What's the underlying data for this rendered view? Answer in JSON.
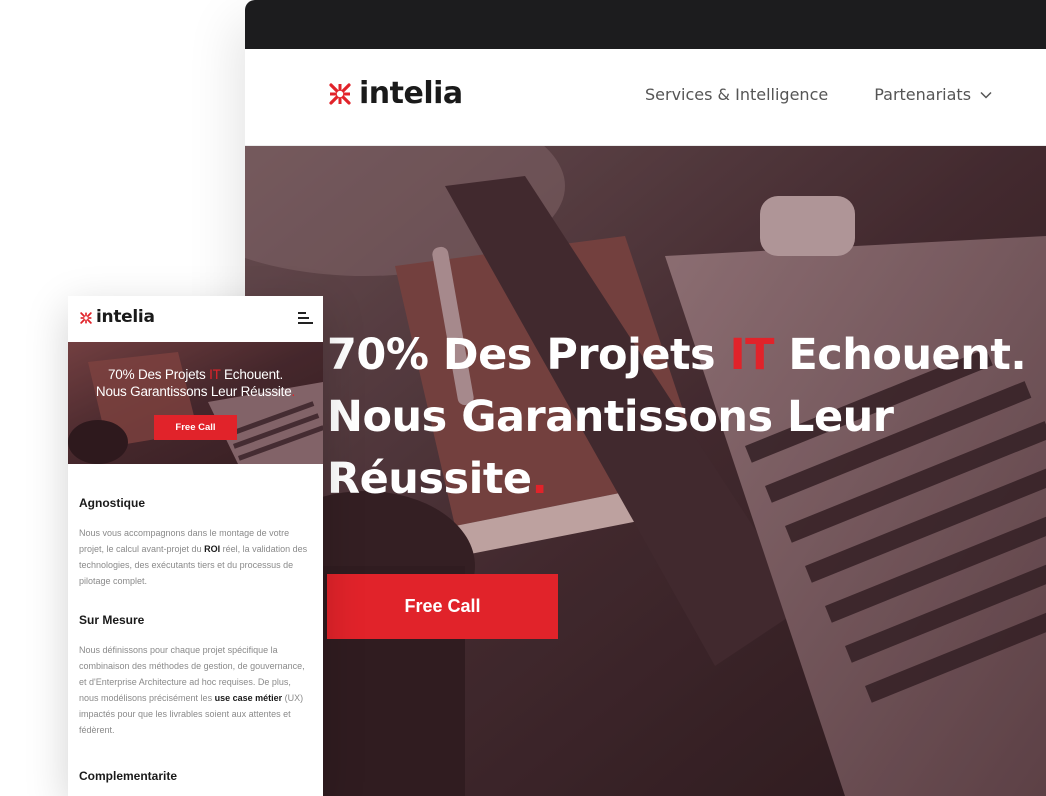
{
  "brand": {
    "name": "intelia",
    "accent": "#e1232a",
    "dark": "#1c1c1e"
  },
  "desktop": {
    "nav": {
      "items": [
        {
          "label": "Services & Intelligence"
        },
        {
          "label": "Partenariats",
          "icon": "chevron-down-icon"
        }
      ]
    },
    "hero": {
      "line1_a": "70% Des Projets ",
      "line1_red": "IT",
      "line1_b": " Echouent.",
      "line2": "Nous Garantissons Leur",
      "line3": "Réussite",
      "dot": ".",
      "cta": "Free Call"
    }
  },
  "mobile": {
    "hero": {
      "line1_a": "70% Des Projets ",
      "line1_red": "IT",
      "line1_b": " Echouent.",
      "line2": "Nous Garantissons Leur Réussite",
      "dot": ".",
      "cta": "Free Call"
    },
    "sections": [
      {
        "title": "Agnostique",
        "text_a": "Nous vous accompagnons dans le montage de votre projet, le calcul avant-projet du ",
        "text_bold": "ROI",
        "text_b": " réel, la validation des technologies, des exécutants tiers et du processus de pilotage complet."
      },
      {
        "title": "Sur Mesure",
        "text_a": "Nous définissons pour chaque projet spécifique la combinaison des méthodes de gestion, de gouvernance, et d'Enterprise Architecture ad hoc requises. De plus, nous modélisons précisément les ",
        "text_bold": "use case métier",
        "text_b": " (UX) impactés pour que les livrables soient aux attentes et fédèrent."
      },
      {
        "title": "Complementarite"
      }
    ]
  }
}
